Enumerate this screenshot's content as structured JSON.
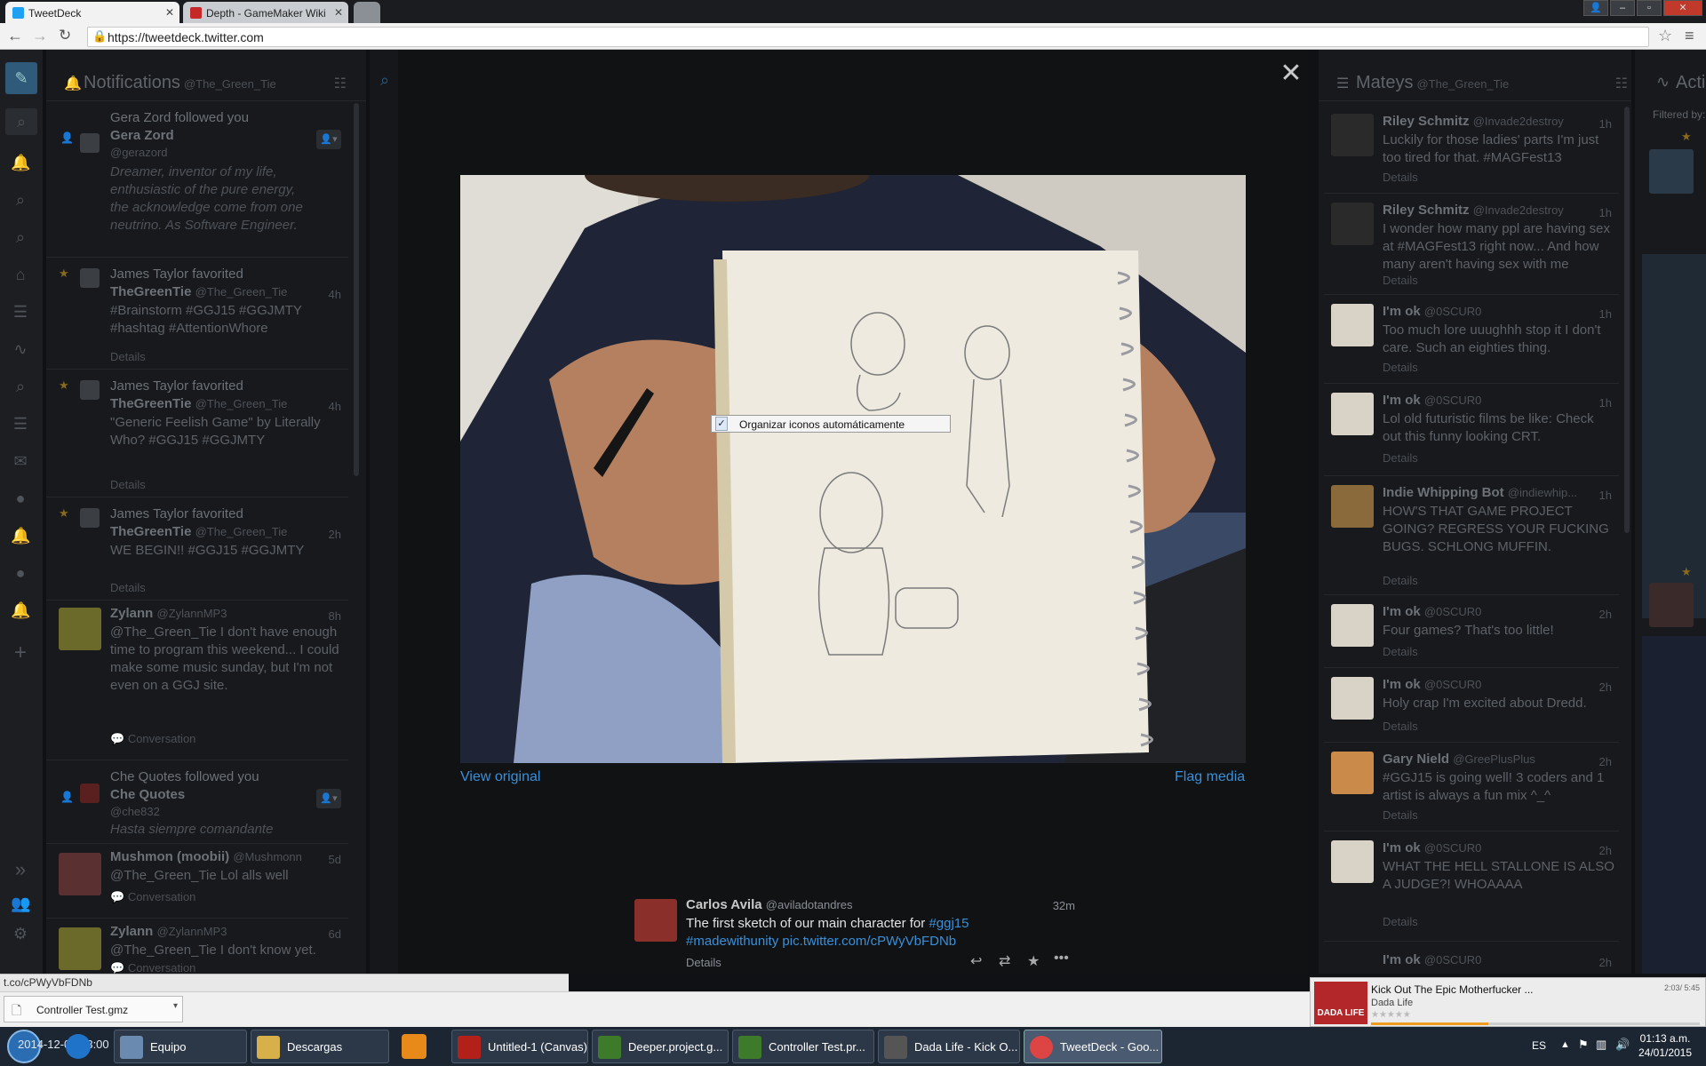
{
  "browser": {
    "tabs": [
      {
        "label": "TweetDeck"
      },
      {
        "label": "Depth - GameMaker Wiki"
      }
    ],
    "url": "https://tweetdeck.twitter.com",
    "status_url": "t.co/cPWyVbFDNb"
  },
  "columns": {
    "notifications": {
      "title": "Notifications",
      "handle": "@The_Green_Tie",
      "items": [
        {
          "line1": "Gera Zord followed you",
          "name": "Gera Zord",
          "handle": "@gerazord",
          "text": "Dreamer, inventor of my life, enthusiastic of the pure energy, the acknowledge come from one neutrino. As Software Engineer."
        },
        {
          "line1": "James Taylor favorited",
          "name": "TheGreenTie",
          "handle": "@The_Green_Tie",
          "time": "4h",
          "text": "#Brainstorm #GGJ15 #GGJMTY #hashtag #AttentionWhore",
          "details": "Details"
        },
        {
          "line1": "James Taylor favorited",
          "name": "TheGreenTie",
          "handle": "@The_Green_Tie",
          "time": "4h",
          "text": "\"Generic Feelish Game\" by Literally Who? #GGJ15 #GGJMTY",
          "details": "Details"
        },
        {
          "line1": "James Taylor favorited",
          "name": "TheGreenTie",
          "handle": "@The_Green_Tie",
          "time": "2h",
          "text": "WE BEGIN!! #GGJ15 #GGJMTY",
          "details": "Details"
        },
        {
          "name": "Zylann",
          "handle": "@ZylannMP3",
          "time": "8h",
          "text": "@The_Green_Tie I don't have enough time to program this weekend... I could make some music sunday, but I'm not even on a GGJ site.",
          "details": "Conversation"
        },
        {
          "line1": "Che Quotes followed you",
          "name": "Che Quotes",
          "handle": "@che832",
          "text": "Hasta siempre comandante"
        },
        {
          "name": "Mushmon (moobii)",
          "handle": "@Mushmonn",
          "time": "5d",
          "text": "@The_Green_Tie Lol alls well",
          "details": "Conversation"
        },
        {
          "name": "Zylann",
          "handle": "@ZylannMP3",
          "time": "6d",
          "text": "@The_Green_Tie I don't know yet.",
          "details": "Conversation"
        }
      ]
    },
    "mateys": {
      "title": "Mateys",
      "handle": "@The_Green_Tie",
      "items": [
        {
          "name": "Riley Schmitz",
          "handle": "@Invade2destroy",
          "time": "1h",
          "text": "Luckily for those ladies' parts I'm just too tired for that. #MAGFest13",
          "details": "Details"
        },
        {
          "name": "Riley Schmitz",
          "handle": "@Invade2destroy",
          "time": "1h",
          "text": "I wonder how many ppl are having sex at #MAGFest13 right now... And how many aren't having sex with me",
          "details": "Details"
        },
        {
          "name": "I'm ok",
          "handle": "@0SCUR0",
          "time": "1h",
          "text": "Too much lore uuughhh stop it I don't care. Such an eighties thing.",
          "details": "Details"
        },
        {
          "name": "I'm ok",
          "handle": "@0SCUR0",
          "time": "1h",
          "text": "Lol old futuristic films be like: Check out this funny looking CRT.",
          "details": "Details"
        },
        {
          "name": "Indie Whipping Bot",
          "handle": "@indiewhip...",
          "time": "1h",
          "text": "HOW'S THAT GAME PROJECT GOING? REGRESS YOUR FUCKING BUGS. SCHLONG MUFFIN.",
          "details": "Details"
        },
        {
          "name": "I'm ok",
          "handle": "@0SCUR0",
          "time": "2h",
          "text": "Four games? That's too little!",
          "details": "Details"
        },
        {
          "name": "I'm ok",
          "handle": "@0SCUR0",
          "time": "2h",
          "text": "Holy crap I'm excited about Dredd.",
          "details": "Details"
        },
        {
          "name": "Gary Nield",
          "handle": "@GreePlusPlus",
          "time": "2h",
          "text": "#GGJ15 is going well! 3 coders and 1 artist is always a fun mix ^_^",
          "details": "Details"
        },
        {
          "name": "I'm ok",
          "handle": "@0SCUR0",
          "time": "2h",
          "text": "WHAT THE HELL STALLONE IS ALSO A JUDGE?! WHOAAAA",
          "details": "Details"
        },
        {
          "name": "I'm ok",
          "handle": "@0SCUR0",
          "time": "2h"
        }
      ]
    },
    "activity": {
      "title": "Acti",
      "filtered": "Filtered by:"
    }
  },
  "media": {
    "view_original": "View original",
    "flag_media": "Flag media",
    "context_menu_item": "Organizar iconos automáticamente",
    "tweet": {
      "name": "Carlos Avila",
      "handle": "@aviladotandres",
      "time": "32m",
      "text1": "The first sketch of our main character for ",
      "tag1": "#ggj15",
      "tag2": "#madewithunity",
      "link": "pic.twitter.com/cPWyVbFDNb",
      "details": "Details"
    }
  },
  "download": {
    "file": "Controller Test.gmz"
  },
  "music": {
    "title": "Kick Out The Epic Motherfucker ...",
    "artist": "Dada Life",
    "time": "2:03/ 5:45",
    "cover_text": "DADA LIFE"
  },
  "taskbar": {
    "items": [
      {
        "label": "Equipo"
      },
      {
        "label": "Descargas"
      },
      {
        "label": "Untitled-1 (Canvas)"
      },
      {
        "label": "Deeper.project.g..."
      },
      {
        "label": "Controller Test.pr..."
      },
      {
        "label": "Dada Life - Kick O..."
      },
      {
        "label": "TweetDeck - Goo..."
      }
    ],
    "lang": "ES",
    "clock_time": "01:13 a.m.",
    "clock_date": "24/01/2015",
    "start_text": "2014-12-02 23:00"
  },
  "colors": {
    "accent": "#3b8fd8",
    "link_dim": "#2a5f86",
    "bg": "#0f1114"
  }
}
